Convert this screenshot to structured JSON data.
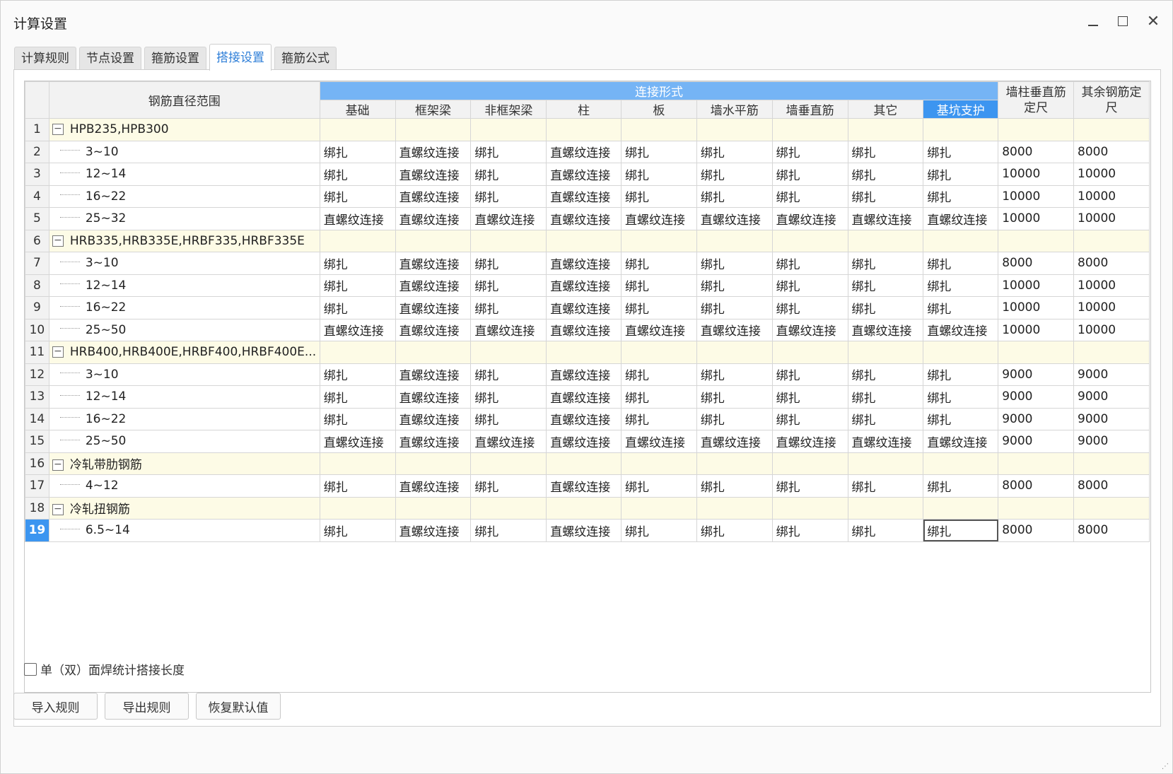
{
  "window": {
    "title": "计算设置"
  },
  "tabs": [
    {
      "label": "计算规则",
      "active": false
    },
    {
      "label": "节点设置",
      "active": false
    },
    {
      "label": "箍筋设置",
      "active": false
    },
    {
      "label": "搭接设置",
      "active": true
    },
    {
      "label": "箍筋公式",
      "active": false
    }
  ],
  "grid": {
    "headers": {
      "range": "钢筋直径范围",
      "connection_group": "连接形式",
      "connection_cols": [
        "基础",
        "框架梁",
        "非框架梁",
        "柱",
        "板",
        "墙水平筋",
        "墙垂直筋",
        "其它",
        "基坑支护"
      ],
      "wall_col_length": "墙柱垂直筋定尺",
      "other_length": "其余钢筋定尺"
    },
    "rows": [
      {
        "num": "1",
        "type": "group",
        "toggle": "−",
        "name": "HPB235,HPB300"
      },
      {
        "num": "2",
        "type": "item",
        "name": "3~10",
        "cells": [
          "绑扎",
          "直螺纹连接",
          "绑扎",
          "直螺纹连接",
          "绑扎",
          "绑扎",
          "绑扎",
          "绑扎",
          "绑扎"
        ],
        "wall": "8000",
        "other": "8000"
      },
      {
        "num": "3",
        "type": "item",
        "name": "12~14",
        "cells": [
          "绑扎",
          "直螺纹连接",
          "绑扎",
          "直螺纹连接",
          "绑扎",
          "绑扎",
          "绑扎",
          "绑扎",
          "绑扎"
        ],
        "wall": "10000",
        "other": "10000"
      },
      {
        "num": "4",
        "type": "item",
        "name": "16~22",
        "cells": [
          "绑扎",
          "直螺纹连接",
          "绑扎",
          "直螺纹连接",
          "绑扎",
          "绑扎",
          "绑扎",
          "绑扎",
          "绑扎"
        ],
        "wall": "10000",
        "other": "10000"
      },
      {
        "num": "5",
        "type": "item",
        "name": "25~32",
        "cells": [
          "直螺纹连接",
          "直螺纹连接",
          "直螺纹连接",
          "直螺纹连接",
          "直螺纹连接",
          "直螺纹连接",
          "直螺纹连接",
          "直螺纹连接",
          "直螺纹连接"
        ],
        "wall": "10000",
        "other": "10000"
      },
      {
        "num": "6",
        "type": "group",
        "toggle": "−",
        "name": "HRB335,HRB335E,HRBF335,HRBF335E"
      },
      {
        "num": "7",
        "type": "item",
        "name": "3~10",
        "cells": [
          "绑扎",
          "直螺纹连接",
          "绑扎",
          "直螺纹连接",
          "绑扎",
          "绑扎",
          "绑扎",
          "绑扎",
          "绑扎"
        ],
        "wall": "8000",
        "other": "8000"
      },
      {
        "num": "8",
        "type": "item",
        "name": "12~14",
        "cells": [
          "绑扎",
          "直螺纹连接",
          "绑扎",
          "直螺纹连接",
          "绑扎",
          "绑扎",
          "绑扎",
          "绑扎",
          "绑扎"
        ],
        "wall": "10000",
        "other": "10000"
      },
      {
        "num": "9",
        "type": "item",
        "name": "16~22",
        "cells": [
          "绑扎",
          "直螺纹连接",
          "绑扎",
          "直螺纹连接",
          "绑扎",
          "绑扎",
          "绑扎",
          "绑扎",
          "绑扎"
        ],
        "wall": "10000",
        "other": "10000"
      },
      {
        "num": "10",
        "type": "item",
        "name": "25~50",
        "cells": [
          "直螺纹连接",
          "直螺纹连接",
          "直螺纹连接",
          "直螺纹连接",
          "直螺纹连接",
          "直螺纹连接",
          "直螺纹连接",
          "直螺纹连接",
          "直螺纹连接"
        ],
        "wall": "10000",
        "other": "10000"
      },
      {
        "num": "11",
        "type": "group",
        "toggle": "−",
        "name": "HRB400,HRB400E,HRBF400,HRBF400E..."
      },
      {
        "num": "12",
        "type": "item",
        "name": "3~10",
        "cells": [
          "绑扎",
          "直螺纹连接",
          "绑扎",
          "直螺纹连接",
          "绑扎",
          "绑扎",
          "绑扎",
          "绑扎",
          "绑扎"
        ],
        "wall": "9000",
        "other": "9000"
      },
      {
        "num": "13",
        "type": "item",
        "name": "12~14",
        "cells": [
          "绑扎",
          "直螺纹连接",
          "绑扎",
          "直螺纹连接",
          "绑扎",
          "绑扎",
          "绑扎",
          "绑扎",
          "绑扎"
        ],
        "wall": "9000",
        "other": "9000"
      },
      {
        "num": "14",
        "type": "item",
        "name": "16~22",
        "cells": [
          "绑扎",
          "直螺纹连接",
          "绑扎",
          "直螺纹连接",
          "绑扎",
          "绑扎",
          "绑扎",
          "绑扎",
          "绑扎"
        ],
        "wall": "9000",
        "other": "9000"
      },
      {
        "num": "15",
        "type": "item",
        "name": "25~50",
        "cells": [
          "直螺纹连接",
          "直螺纹连接",
          "直螺纹连接",
          "直螺纹连接",
          "直螺纹连接",
          "直螺纹连接",
          "直螺纹连接",
          "直螺纹连接",
          "直螺纹连接"
        ],
        "wall": "9000",
        "other": "9000"
      },
      {
        "num": "16",
        "type": "group",
        "toggle": "−",
        "name": "冷轧带肋钢筋"
      },
      {
        "num": "17",
        "type": "item",
        "name": "4~12",
        "cells": [
          "绑扎",
          "直螺纹连接",
          "绑扎",
          "直螺纹连接",
          "绑扎",
          "绑扎",
          "绑扎",
          "绑扎",
          "绑扎"
        ],
        "wall": "8000",
        "other": "8000"
      },
      {
        "num": "18",
        "type": "group",
        "toggle": "−",
        "name": "冷轧扭钢筋"
      },
      {
        "num": "19",
        "type": "item",
        "name": "6.5~14",
        "selected": true,
        "cells": [
          "绑扎",
          "直螺纹连接",
          "绑扎",
          "直螺纹连接",
          "绑扎",
          "绑扎",
          "绑扎",
          "绑扎",
          "绑扎"
        ],
        "wall": "8000",
        "other": "8000"
      }
    ]
  },
  "options": {
    "weld_checkbox_label": "单（双）面焊统计搭接长度",
    "weld_checked": false
  },
  "buttons": {
    "import": "导入规则",
    "export": "导出规则",
    "restore": "恢复默认值"
  },
  "colors": {
    "accent": "#3c95f0",
    "group_row_bg": "#fdfbe6",
    "active_tab_text": "#2f7fd8"
  }
}
